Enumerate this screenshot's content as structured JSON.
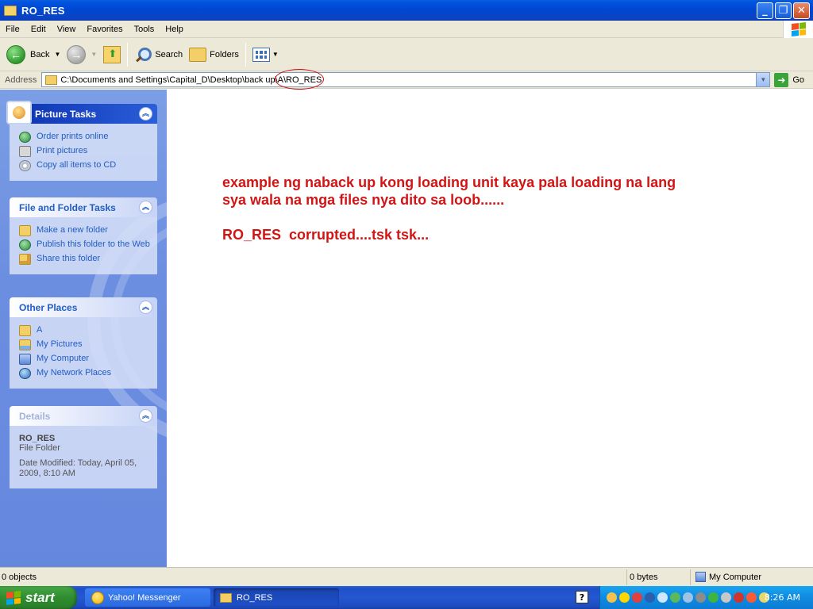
{
  "window": {
    "title": "RO_RES"
  },
  "menu": [
    "File",
    "Edit",
    "View",
    "Favorites",
    "Tools",
    "Help"
  ],
  "toolbar": {
    "back_label": "Back",
    "search_label": "Search",
    "folders_label": "Folders"
  },
  "address": {
    "label": "Address",
    "value": "C:\\Documents and Settings\\Capital_D\\Desktop\\back up\\A\\RO_RES",
    "go_label": "Go"
  },
  "picture_tasks": {
    "title": "Picture Tasks",
    "items": [
      "Order prints online",
      "Print pictures",
      "Copy all items to CD"
    ]
  },
  "file_folder_tasks": {
    "title": "File and Folder Tasks",
    "items": [
      "Make a new folder",
      "Publish this folder to the Web",
      "Share this folder"
    ]
  },
  "other_places": {
    "title": "Other Places",
    "items": [
      "A",
      "My Pictures",
      "My Computer",
      "My Network Places"
    ]
  },
  "details": {
    "title": "Details",
    "name": "RO_RES",
    "type": "File Folder",
    "modified": "Date Modified: Today, April 05, 2009, 8:10 AM"
  },
  "content": {
    "line1": "example ng naback up kong loading unit kaya pala loading na lang",
    "line2": "sya wala na mga files nya dito sa loob......",
    "line3": "RO_RES  corrupted....tsk tsk..."
  },
  "status": {
    "objects": "0 objects",
    "size": "0 bytes",
    "location": "My Computer"
  },
  "taskbar": {
    "start_label": "start",
    "tasks": [
      "Yahoo! Messenger",
      "RO_RES"
    ],
    "help_glyph": "?",
    "clock": "8:26 AM"
  },
  "colors": {
    "accent_red": "#d11515",
    "xp_blue": "#0046d0",
    "task_link": "#215dc6"
  }
}
